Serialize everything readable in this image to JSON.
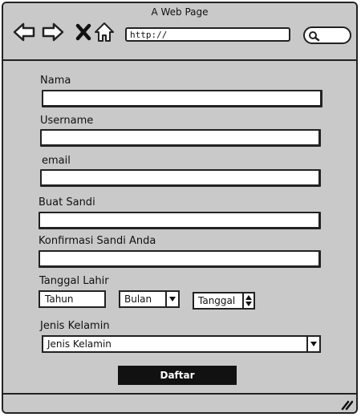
{
  "window": {
    "title": "A Web Page"
  },
  "browser": {
    "url": "http://",
    "icons": [
      "back-arrow-icon",
      "forward-arrow-icon",
      "close-x-icon",
      "home-icon",
      "search-icon",
      "resize-grip-icon"
    ]
  },
  "form": {
    "nama_label": "Nama",
    "username_label": "Username",
    "email_label": "email",
    "sandi_label": "Buat Sandi",
    "konfirmasi_label": "Konfirmasi Sandi Anda",
    "tanggal_lahir_label": "Tanggal Lahir",
    "tahun_value": "Tahun",
    "bulan_value": "Bulan",
    "tanggal_value": "Tanggal",
    "jenis_kelamin_label": "Jenis Kelamin",
    "jenis_kelamin_value": "Jenis Kelamin",
    "submit_label": "Daftar"
  }
}
